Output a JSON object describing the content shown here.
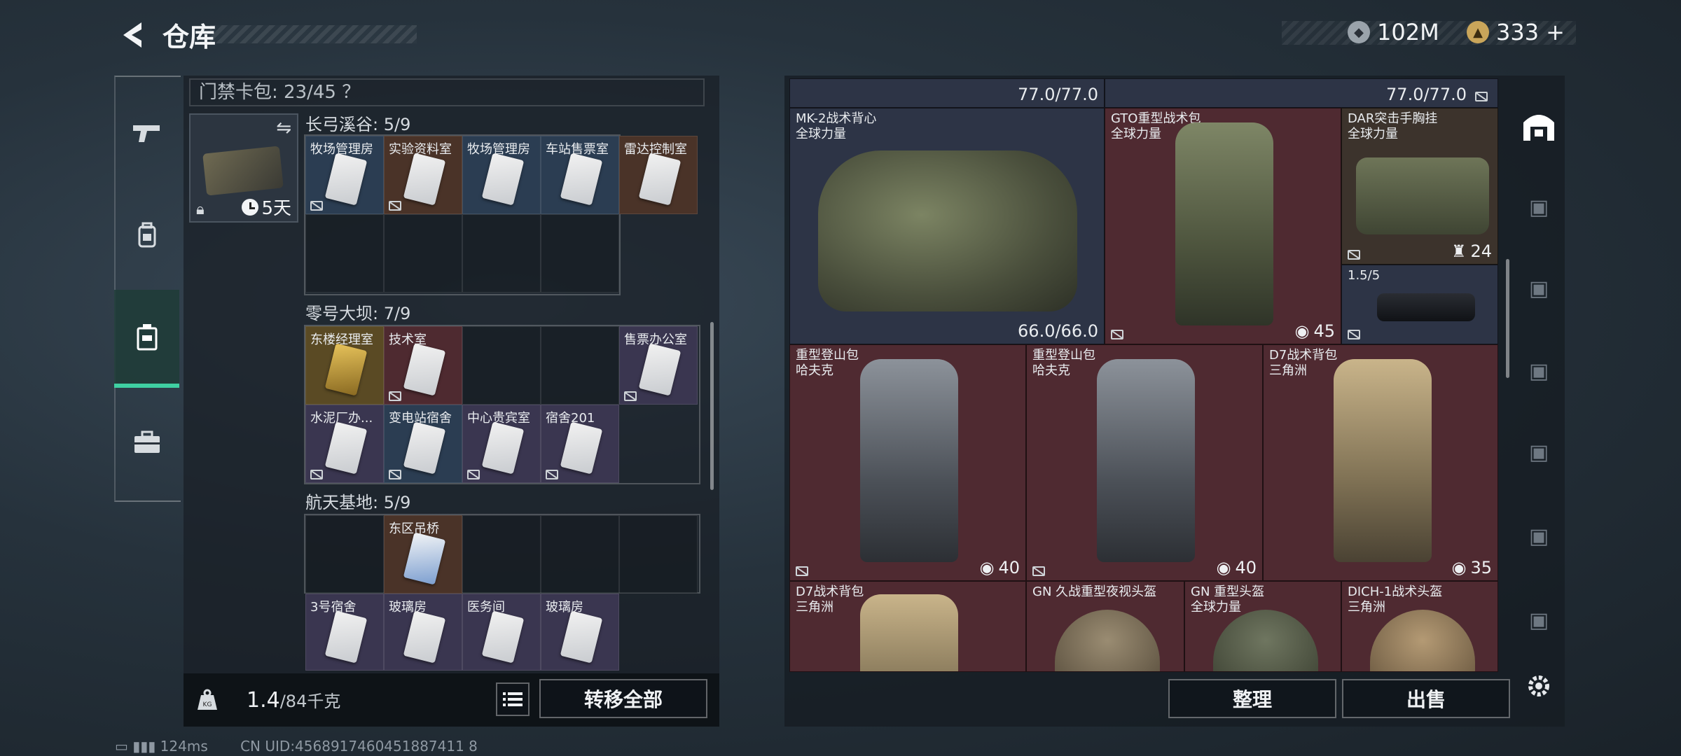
{
  "header": {
    "title": "仓库",
    "currency1": "102M",
    "currency2": "333",
    "plus": "+"
  },
  "left": {
    "gate_pack": "门禁卡包: 23/45 ？",
    "keybag_days": "5天",
    "sections": [
      {
        "title": "长弓溪谷: 5/9",
        "items": [
          "牧场管理房",
          "实验资料室",
          "牧场管理房",
          "车站售票室",
          "雷达控制室"
        ]
      },
      {
        "title": "零号大坝: 7/9",
        "items": [
          "东楼经理室",
          "技术室",
          "售票办公室",
          "水泥厂办...",
          "变电站宿舍",
          "中心贵宾室",
          "宿舍201"
        ]
      },
      {
        "title": "航天基地: 5/9",
        "items": [
          "东区吊桥",
          "3号宿舍",
          "玻璃房",
          "医务间",
          "玻璃房"
        ]
      }
    ],
    "weight_value": "1.4",
    "weight_max": "/84千克",
    "kg_label": "KG",
    "transfer_all": "转移全部"
  },
  "right": {
    "top_durability": [
      "77.0/77.0",
      "77.0/77.0"
    ],
    "items": [
      {
        "name": "MK-2战术背心",
        "sub": "全球力量",
        "value": "66.0/66.0"
      },
      {
        "name": "GTO重型战术包",
        "sub": "全球力量",
        "value": "45"
      },
      {
        "name": "DAR突击手胸挂",
        "sub": "全球力量",
        "value": "24"
      },
      {
        "name": "1.5/5",
        "sub": "",
        "value": ""
      },
      {
        "name": "重型登山包",
        "sub": "哈夫克",
        "value": "40"
      },
      {
        "name": "重型登山包",
        "sub": "哈夫克",
        "value": "40"
      },
      {
        "name": "D7战术背包",
        "sub": "三角洲",
        "value": "35"
      },
      {
        "name": "D7战术背包",
        "sub": "三角洲",
        "value": ""
      },
      {
        "name": "GN 久战重型夜视头盔",
        "sub": "",
        "value": ""
      },
      {
        "name": "GN 重型头盔",
        "sub": "全球力量",
        "value": ""
      },
      {
        "name": "DICH-1战术头盔",
        "sub": "三角洲",
        "value": ""
      }
    ],
    "sort_btn": "整理",
    "sell_btn": "出售"
  },
  "status": {
    "ping": "124ms",
    "uid": "CN UID:4568917460451887411 8"
  },
  "colors": {
    "accent": "#3fd0a2",
    "bg": "#26323c"
  }
}
